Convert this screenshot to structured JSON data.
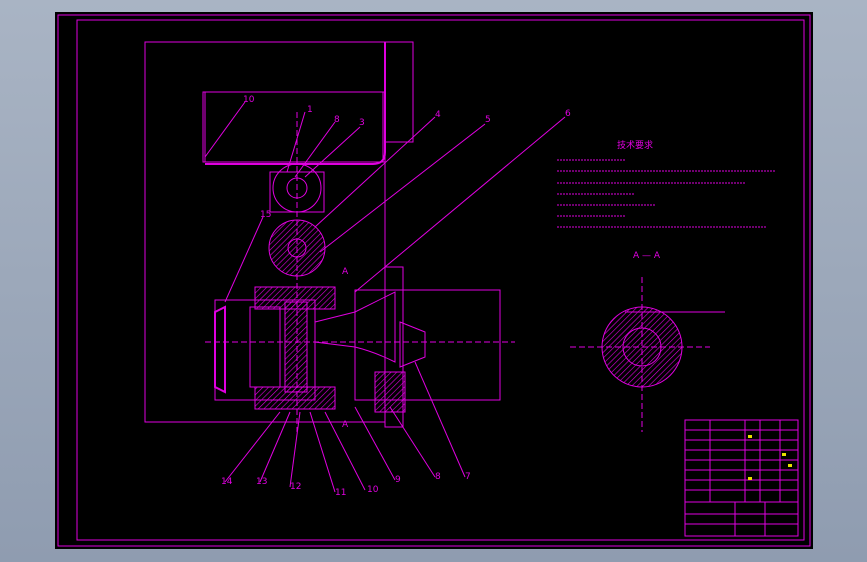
{
  "drawing": {
    "balloons": [
      "10",
      "1",
      "8",
      "3",
      "4",
      "5",
      "6",
      "15",
      "14",
      "13",
      "12",
      "11",
      "10",
      "9",
      "8",
      "7"
    ],
    "section_label": "A — A",
    "section_arrow_label": "A",
    "section_arrow_label_bottom": "A",
    "tech_title": "技术要求"
  },
  "colors": {
    "background": "#000000",
    "lines": "#e000e0",
    "highlight": "#e8e000",
    "window": "#8f9cb0"
  }
}
